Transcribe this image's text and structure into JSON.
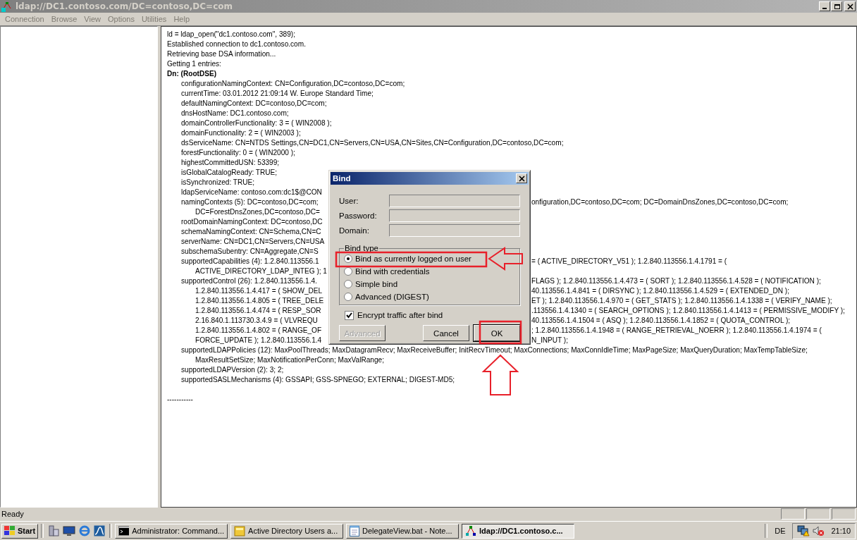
{
  "window": {
    "title": "ldap://DC1.contoso.com/DC=contoso,DC=com"
  },
  "menu": [
    {
      "label": "Connection"
    },
    {
      "label": "Browse"
    },
    {
      "label": "View"
    },
    {
      "label": "Options"
    },
    {
      "label": "Utilities"
    },
    {
      "label": "Help"
    }
  ],
  "output": {
    "lines": [
      {
        "kind": "plain",
        "text": "ld = ldap_open(\"dc1.contoso.com\", 389);"
      },
      {
        "kind": "plain",
        "text": "Established connection to dc1.contoso.com."
      },
      {
        "kind": "plain",
        "text": "Retrieving base DSA information..."
      },
      {
        "kind": "plain",
        "text": "Getting 1 entries:"
      },
      {
        "kind": "header",
        "text": "Dn: (RootDSE)"
      },
      {
        "kind": "attr",
        "text": "configurationNamingContext: CN=Configuration,DC=contoso,DC=com;"
      },
      {
        "kind": "attr",
        "text": "currentTime: 03.01.2012 21:09:14 W. Europe Standard Time;"
      },
      {
        "kind": "attr",
        "text": "defaultNamingContext: DC=contoso,DC=com;"
      },
      {
        "kind": "attr",
        "text": "dnsHostName: DC1.contoso.com;"
      },
      {
        "kind": "attr",
        "text": "domainControllerFunctionality: 3 = ( WIN2008 );"
      },
      {
        "kind": "attr",
        "text": "domainFunctionality: 2 = ( WIN2003 );"
      },
      {
        "kind": "attr",
        "text": "dsServiceName: CN=NTDS Settings,CN=DC1,CN=Servers,CN=USA,CN=Sites,CN=Configuration,DC=contoso,DC=com;"
      },
      {
        "kind": "attr",
        "text": "forestFunctionality: 0 = ( WIN2000 );"
      },
      {
        "kind": "attr",
        "text": "highestCommittedUSN: 53399;"
      },
      {
        "kind": "attr",
        "text": "isGlobalCatalogReady: TRUE;"
      },
      {
        "kind": "attr",
        "text": "isSynchronized: TRUE;"
      },
      {
        "kind": "attr",
        "text": "ldapServiceName: contoso.com:dc1$@CON"
      },
      {
        "kind": "attr",
        "text": "namingContexts (5): DC=contoso,DC=com;",
        "right": "onfiguration,DC=contoso,DC=com; DC=DomainDnsZones,DC=contoso,DC=com;"
      },
      {
        "kind": "cont",
        "text": "DC=ForestDnsZones,DC=contoso,DC="
      },
      {
        "kind": "attr",
        "text": "rootDomainNamingContext: DC=contoso,DC"
      },
      {
        "kind": "attr",
        "text": "schemaNamingContext: CN=Schema,CN=C"
      },
      {
        "kind": "attr",
        "text": "serverName: CN=DC1,CN=Servers,CN=USA"
      },
      {
        "kind": "attr",
        "text": "subschemaSubentry: CN=Aggregate,CN=S"
      },
      {
        "kind": "attr",
        "text": "supportedCapabilities (4): 1.2.840.113556.1",
        "right": "= ( ACTIVE_DIRECTORY_V51 ); 1.2.840.113556.1.4.1791 = ("
      },
      {
        "kind": "cont",
        "text": "ACTIVE_DIRECTORY_LDAP_INTEG ); 1"
      },
      {
        "kind": "attr",
        "text": "supportedControl (26): 1.2.840.113556.1.4.",
        "right": "FLAGS ); 1.2.840.113556.1.4.473 = ( SORT ); 1.2.840.113556.1.4.528 = ( NOTIFICATION );"
      },
      {
        "kind": "cont",
        "text": "1.2.840.113556.1.4.417 = ( SHOW_DEL",
        "right": "40.113556.1.4.841 = ( DIRSYNC ); 1.2.840.113556.1.4.529 = ( EXTENDED_DN );"
      },
      {
        "kind": "cont",
        "text": "1.2.840.113556.1.4.805 = ( TREE_DELE",
        "right": "ET ); 1.2.840.113556.1.4.970 = ( GET_STATS ); 1.2.840.113556.1.4.1338 = ( VERIFY_NAME );"
      },
      {
        "kind": "cont",
        "text": "1.2.840.113556.1.4.474 = ( RESP_SOR",
        "right": ".113556.1.4.1340 = ( SEARCH_OPTIONS ); 1.2.840.113556.1.4.1413 = ( PERMISSIVE_MODIFY );"
      },
      {
        "kind": "cont",
        "text": "2.16.840.1.113730.3.4.9 = ( VLVREQU",
        "right": "40.113556.1.4.1504 = ( ASQ ); 1.2.840.113556.1.4.1852 = ( QUOTA_CONTROL );"
      },
      {
        "kind": "cont",
        "text": "1.2.840.113556.1.4.802 = ( RANGE_OF",
        "right": "; 1.2.840.113556.1.4.1948 = ( RANGE_RETRIEVAL_NOERR ); 1.2.840.113556.1.4.1974 = ("
      },
      {
        "kind": "cont",
        "text": "FORCE_UPDATE ); 1.2.840.113556.1.4",
        "right": "N_INPUT );"
      },
      {
        "kind": "attr",
        "text": "supportedLDAPPolicies (12): MaxPoolThreads; MaxDatagramRecv; MaxReceiveBuffer; InitRecvTimeout; MaxConnections; MaxConnIdleTime; MaxPageSize; MaxQueryDuration; MaxTempTableSize;"
      },
      {
        "kind": "cont",
        "text": "MaxResultSetSize; MaxNotificationPerConn; MaxValRange;"
      },
      {
        "kind": "attr",
        "text": "supportedLDAPVersion (2): 3; 2;"
      },
      {
        "kind": "attr",
        "text": "supportedSASLMechanisms (4): GSSAPI; GSS-SPNEGO; EXTERNAL; DIGEST-MD5;"
      },
      {
        "kind": "blank"
      },
      {
        "kind": "plain",
        "text": "-----------"
      }
    ]
  },
  "dialog": {
    "title": "Bind",
    "fields": [
      {
        "label": "User:",
        "disabled": true
      },
      {
        "label": "Password:",
        "disabled": true
      },
      {
        "label": "Domain:",
        "disabled": true
      }
    ],
    "group_label": "Bind type",
    "bind_types": [
      {
        "label": "Bind as currently logged on user",
        "selected": true
      },
      {
        "label": "Bind with credentials",
        "selected": false
      },
      {
        "label": "Simple bind",
        "selected": false
      },
      {
        "label": "Advanced (DIGEST)",
        "selected": false
      }
    ],
    "encrypt": {
      "label": "Encrypt traffic after bind",
      "checked": true
    },
    "buttons": [
      {
        "label": "Advanced",
        "disabled": true
      },
      {
        "label": "Cancel",
        "disabled": false
      },
      {
        "label": "OK",
        "disabled": false
      }
    ]
  },
  "status_bar": {
    "text": "Ready"
  },
  "taskbar": {
    "start": "Start",
    "tasks": [
      {
        "kind": "console",
        "label": "Administrator: Command...",
        "selected": false
      },
      {
        "kind": "folder",
        "label": "Active Directory Users a...",
        "selected": false
      },
      {
        "kind": "notepad",
        "label": "DelegateView.bat - Note...",
        "selected": false
      },
      {
        "kind": "ldp",
        "label": "ldap://DC1.contoso.c...",
        "selected": true
      }
    ],
    "language": "DE",
    "clock": "21:10"
  }
}
